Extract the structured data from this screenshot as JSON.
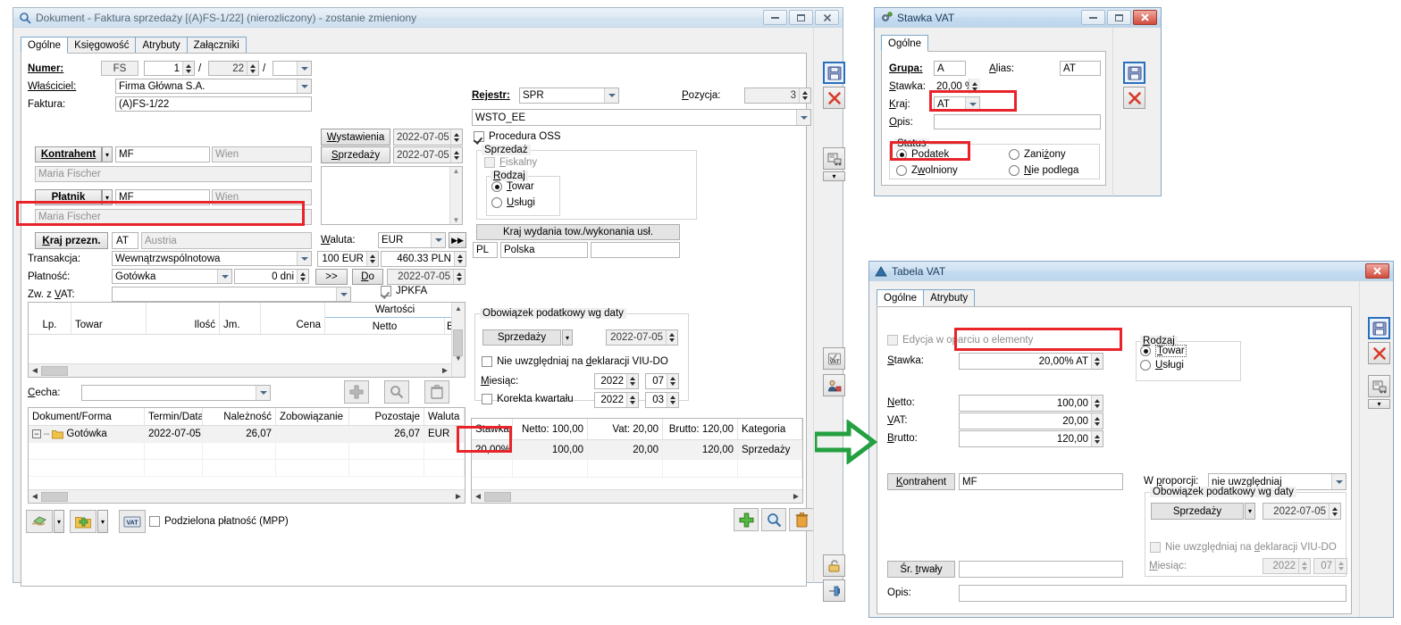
{
  "main_window": {
    "title": "Dokument - Faktura sprzedaży [(A)FS-1/22] (nierozliczony) - zostanie zmieniony",
    "icon": "magnifier-icon",
    "buttons": {
      "minimize": "minimize-icon",
      "maximize": "maximize-icon",
      "close": "close-icon"
    },
    "tabs": [
      {
        "label": "Ogólne",
        "selected": true
      },
      {
        "label": "Księgowość",
        "selected": false
      },
      {
        "label": "Atrybuty",
        "selected": false
      },
      {
        "label": "Załączniki",
        "selected": false
      }
    ],
    "left": {
      "numer_label": "Numer:",
      "numer_series": "FS",
      "numer_no": "1",
      "numer_year": "22",
      "numer_extra": "",
      "wlasciciel_label": "Właściciel:",
      "wlasciciel_value": "Firma Główna S.A.",
      "faktura_label": "Faktura:",
      "faktura_value": "(A)FS-1/22",
      "kontrahent_label": "Kontrahent",
      "kontrahent_code": "MF",
      "kontrahent_city": "Wien",
      "kontrahent_name": "Maria Fischer",
      "platnik_label": "Płatnik",
      "platnik_code": "MF",
      "platnik_city": "Wien",
      "platnik_name": "Maria Fischer",
      "kraj_przezn_label": "Kraj przezn.",
      "kraj_przezn_code": "AT",
      "kraj_przezn_name": "Austria",
      "transakcja_label": "Transakcja:",
      "transakcja_value": "Wewnątrzwspólnotowa",
      "platnosc_label": "Płatność:",
      "platnosc_value": "Gotówka",
      "platnosc_days": "0 dni",
      "zw_vat_label": "Zw. z VAT:",
      "zw_vat_value": "",
      "cecha_label": "Cecha:",
      "cecha_value": ""
    },
    "dates": {
      "wystawienia_label": "Wystawienia",
      "wystawienia_value": "2022-07-05",
      "sprzedazy_label": "Sprzedaży",
      "sprzedazy_value": "2022-07-05",
      "waluta_label": "Waluta:",
      "waluta_value": "EUR",
      "kurs_from": "100 EUR",
      "kurs_to": "460.33 PLN",
      "more_button": "▶▶",
      "gt_button": ">>",
      "do_button": "Do",
      "do_value": "2022-07-05",
      "jpkfa_label": "JPKFA"
    },
    "right": {
      "rejestr_label": "Rejestr:",
      "rejestr_value": "SPR",
      "pozycja_label": "Pozycja:",
      "pozycja_value": "3",
      "wsto_value": "WSTO_EE",
      "procedura_oss": "Procedura OSS",
      "sprzedaz_group": "Sprzedaż",
      "fiskalny": "Fiskalny",
      "rodzaj_group": "Rodzaj",
      "rodzaj_towar": "Towar",
      "rodzaj_uslugi": "Usługi",
      "kraj_wydania_button": "Kraj wydania tow./wykonania usł.",
      "kraj_wydania_code": "PL",
      "kraj_wydania_name": "Polska",
      "kraj_wydania_extra": ""
    },
    "obowiazek": {
      "group_title": "Obowiązek podatkowy wg daty",
      "typ": "Sprzedaży",
      "data": "2022-07-05",
      "nie_uwzgledniaj": "Nie uwzględniaj na deklaracji VIU-DO",
      "miesiac_label": "Miesiąc:",
      "miesiac_year": "2022",
      "miesiac_month": "07",
      "korekta_label": "Korekta kwartału",
      "korekta_year": "2022",
      "korekta_q": "03"
    },
    "items_grid": {
      "columns": [
        "Lp.",
        "Towar",
        "Ilość",
        "Jm.",
        "Cena",
        "Wartości"
      ],
      "subcolumns": [
        "Netto",
        "B"
      ],
      "rows": []
    },
    "payments_grid": {
      "columns": [
        "Dokument/Forma",
        "Termin/Data",
        "Należność",
        "Zobowiązanie",
        "Pozostaje",
        "Waluta"
      ],
      "rows": [
        {
          "forma": "Gotówka",
          "termin": "2022-07-05",
          "naleznosc": "26,07",
          "zobowiazanie": "",
          "pozostaje": "26,07",
          "waluta": "EUR"
        }
      ]
    },
    "vat_grid": {
      "columns": [
        "Stawka",
        "Netto: 100,00",
        "Vat: 20,00",
        "Brutto: 120,00",
        "Kategoria"
      ],
      "rows": [
        {
          "stawka": "20,00%",
          "netto": "100,00",
          "vat": "20,00",
          "brutto": "120,00",
          "kategoria": "Sprzedaży"
        }
      ]
    },
    "bottom_bar": {
      "pay_icon": "money-hand-icon",
      "add_folder_icon": "add-folder-icon",
      "vat_icon": "vat-icon",
      "mpp_label": "Podzielona płatność (MPP)",
      "add_icon": "plus-icon",
      "search_icon": "magnifier-icon",
      "delete_icon": "trash-icon"
    },
    "items_bar": {
      "add_icon": "plus-icon",
      "search_icon": "magnifier-icon",
      "delete_icon": "trash-icon"
    },
    "side_toolbar": [
      {
        "icon": "save-icon",
        "name": "save-button",
        "selected": true
      },
      {
        "icon": "close-x-icon",
        "name": "cancel-button",
        "selected": false
      },
      {
        "icon": "print-icon",
        "name": "print-button",
        "selected": false
      },
      {
        "icon": "dropdown-caret",
        "name": "print-dropdown",
        "selected": false
      },
      {
        "icon": "vat-register-icon",
        "name": "vat-register-button",
        "selected": false
      },
      {
        "icon": "contractor-icon",
        "name": "contractor-button",
        "selected": false
      },
      {
        "icon": "lock-icon",
        "name": "lock-button",
        "selected": false
      },
      {
        "icon": "pin-icon",
        "name": "pin-button",
        "selected": false
      }
    ]
  },
  "stawka_vat_window": {
    "title": "Stawka VAT",
    "icon": "gear-icon",
    "tabs": [
      {
        "label": "Ogólne",
        "selected": true
      }
    ],
    "grupa_label": "Grupa:",
    "grupa_value": "A",
    "alias_label": "Alias:",
    "alias_value": "AT",
    "stawka_label": "Stawka:",
    "stawka_value": "20,00 %",
    "kraj_label": "Kraj:",
    "kraj_value": "AT",
    "opis_label": "Opis:",
    "opis_value": "",
    "status_group": "Status",
    "status_podatek": "Podatek",
    "status_zanizony": "Zaniżony",
    "status_zwolniony": "Zwolniony",
    "status_nie_podlega": "Nie podlega",
    "toolbar": [
      {
        "icon": "save-icon",
        "name": "save-button",
        "selected": true
      },
      {
        "icon": "close-x-icon",
        "name": "cancel-button",
        "selected": false
      }
    ]
  },
  "tabela_vat_window": {
    "title": "Tabela VAT",
    "icon": "triangle-icon",
    "tabs": [
      {
        "label": "Ogólne",
        "selected": true
      },
      {
        "label": "Atrybuty",
        "selected": false
      }
    ],
    "edycja_label": "Edycja w oparciu o elementy",
    "stawka_label": "Stawka:",
    "stawka_value": "20,00% AT",
    "rodzaj_group": "Rodzaj",
    "rodzaj_towar": "Towar",
    "rodzaj_uslugi": "Usługi",
    "netto_label": "Netto:",
    "netto_value": "100,00",
    "vat_label": "VAT:",
    "vat_value": "20,00",
    "brutto_label": "Brutto:",
    "brutto_value": "120,00",
    "kontrahent_label": "Kontrahent",
    "kontrahent_value": "MF",
    "sr_trwaly_label": "Śr. trwały",
    "sr_trwaly_value": "",
    "opis_label": "Opis:",
    "opis_value": "",
    "w_proporcji_label": "W proporcji:",
    "w_proporcji_value": "nie uwzględniaj",
    "obowiazek_group": "Obowiązek podatkowy wg daty",
    "obowiazek_typ": "Sprzedaży",
    "obowiazek_data": "2022-07-05",
    "nie_uwzgledniaj": "Nie uwzględniaj na deklaracji VIU-DO",
    "miesiac_label": "Miesiąc:",
    "miesiac_year": "2022",
    "miesiac_month": "07",
    "toolbar": [
      {
        "icon": "save-icon",
        "name": "save-button",
        "selected": true
      },
      {
        "icon": "close-x-icon",
        "name": "cancel-button",
        "selected": false
      },
      {
        "icon": "print-icon",
        "name": "print-button",
        "selected": false
      },
      {
        "icon": "dropdown-caret",
        "name": "print-dropdown",
        "selected": false
      }
    ]
  },
  "annotations": {
    "arrow": "green-right-arrow",
    "highlight_color": "#e8232a"
  }
}
